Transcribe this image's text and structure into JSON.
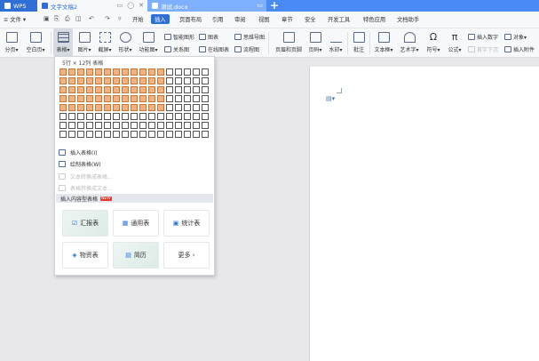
{
  "titlebar": {
    "tabs": [
      {
        "label": "WPS",
        "icon": "wps-logo-icon"
      },
      {
        "label": "文字文稿2",
        "icon": "doc-icon"
      },
      {
        "label": "测试.docx",
        "icon": "doc-icon"
      }
    ],
    "new_tab": "+"
  },
  "menubar": {
    "file": "≡ 文件 ▾",
    "items": [
      "开始",
      "插入",
      "页面布局",
      "引用",
      "审阅",
      "视图",
      "章节",
      "安全",
      "开发工具",
      "特色应用",
      "文档助手"
    ],
    "active": "插入"
  },
  "ribbon": {
    "buttons": [
      {
        "label": "分页▾",
        "icon": "page-break-icon"
      },
      {
        "label": "空白页▾",
        "icon": "blank-page-icon"
      },
      {
        "label": "表格▾",
        "icon": "table-icon"
      },
      {
        "label": "图片▾",
        "icon": "picture-icon"
      },
      {
        "label": "截屏▾",
        "icon": "screenshot-icon"
      },
      {
        "label": "形状▾",
        "icon": "shape-icon"
      },
      {
        "label": "功能图▾",
        "icon": "function-chart-icon"
      },
      {
        "label": "页眉和页脚",
        "icon": "header-footer-icon"
      },
      {
        "label": "页码▾",
        "icon": "page-number-icon"
      },
      {
        "label": "水印▾",
        "icon": "watermark-icon"
      },
      {
        "label": "批注",
        "icon": "comment-icon"
      },
      {
        "label": "文本框▾",
        "icon": "textbox-icon"
      },
      {
        "label": "艺术字▾",
        "icon": "wordart-icon"
      },
      {
        "label": "符号▾",
        "icon": "symbol-icon"
      },
      {
        "label": "公式▾",
        "icon": "formula-icon"
      }
    ],
    "small": [
      {
        "label": "智能图形",
        "icon": "smart-graphic-icon"
      },
      {
        "label": "图表",
        "icon": "chart-icon"
      },
      {
        "label": "思维导图",
        "icon": "mindmap-icon"
      },
      {
        "label": "关系图",
        "icon": "relation-icon"
      },
      {
        "label": "在线图表",
        "icon": "online-chart-icon"
      },
      {
        "label": "流程图",
        "icon": "flowchart-icon"
      },
      {
        "label": "插入数字",
        "icon": "insert-number-icon"
      },
      {
        "label": "对象▾",
        "icon": "object-icon"
      },
      {
        "label": "首字下沉",
        "icon": "drop-cap-icon"
      },
      {
        "label": "插入附件",
        "icon": "attachment-icon"
      }
    ]
  },
  "dropdown": {
    "grid_label": "5行 × 12列 表格",
    "rows": 8,
    "cols": 17,
    "selected_rows": 5,
    "selected_cols": 12,
    "items": [
      {
        "label": "插入表格(I)",
        "icon": "insert-table-icon",
        "enabled": true
      },
      {
        "label": "绘制表格(W)",
        "icon": "draw-table-icon",
        "enabled": true
      },
      {
        "label": "文本转换成表格...",
        "icon": "text-to-table-icon",
        "enabled": false
      },
      {
        "label": "表格转换成文本...",
        "icon": "table-to-text-icon",
        "enabled": false
      }
    ],
    "smart_header": "插入内容型表格",
    "new_badge": "NEW",
    "templates": [
      {
        "label": "汇报表",
        "icon": "report-table-icon"
      },
      {
        "label": "通用表",
        "icon": "general-table-icon"
      },
      {
        "label": "统计表",
        "icon": "stat-table-icon"
      },
      {
        "label": "物资表",
        "icon": "supplies-table-icon"
      },
      {
        "label": "简历",
        "icon": "resume-icon"
      },
      {
        "label": "更多 ›",
        "icon": ""
      }
    ]
  },
  "colors": {
    "accent": "#2f6fd6",
    "titlebar": "#4a8af4",
    "grid_selected": "#f6b07c"
  }
}
